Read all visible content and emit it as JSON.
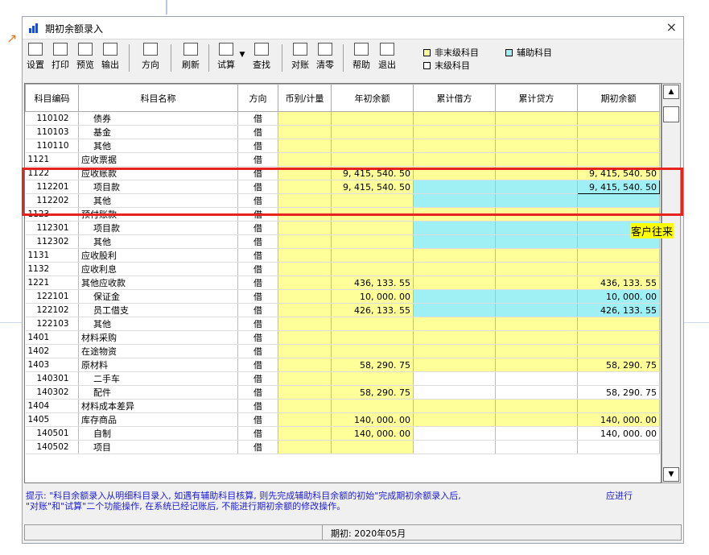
{
  "window": {
    "title": "期初余额录入",
    "close": "×"
  },
  "toolbar": [
    {
      "label": "设置",
      "icon": "settings-icon"
    },
    {
      "label": "打印",
      "icon": "print-icon"
    },
    {
      "label": "预览",
      "icon": "preview-icon"
    },
    {
      "label": "输出",
      "icon": "export-icon"
    },
    {
      "label": "方向",
      "icon": "direction-icon"
    },
    {
      "label": "刷新",
      "icon": "refresh-icon"
    },
    {
      "label": "试算",
      "icon": "trial-balance-icon"
    },
    {
      "label": "查找",
      "icon": "find-icon"
    },
    {
      "label": "对账",
      "icon": "reconcile-icon"
    },
    {
      "label": "清零",
      "icon": "clear-icon"
    },
    {
      "label": "帮助",
      "icon": "help-icon"
    },
    {
      "label": "退出",
      "icon": "exit-icon"
    }
  ],
  "legend": {
    "nonleaf": "非末级科目",
    "leaf": "末级科目",
    "aux": "辅助科目"
  },
  "columns": [
    "科目编码",
    "科目名称",
    "方向",
    "币别/计量",
    "年初余额",
    "累计借方",
    "累计贷方",
    "期初余额"
  ],
  "rows": [
    {
      "code": "110102",
      "name": "债券",
      "dir": "借",
      "open": "",
      "close": "",
      "indent": true,
      "style": "y"
    },
    {
      "code": "110103",
      "name": "基金",
      "dir": "借",
      "open": "",
      "close": "",
      "indent": true,
      "style": "y"
    },
    {
      "code": "110110",
      "name": "其他",
      "dir": "借",
      "open": "",
      "close": "",
      "indent": true,
      "style": "y"
    },
    {
      "code": "1121",
      "name": "应收票据",
      "dir": "借",
      "open": "",
      "close": "",
      "indent": false,
      "style": "y"
    },
    {
      "code": "1122",
      "name": "应收账款",
      "dir": "借",
      "open": "9, 415, 540. 50",
      "close": "9, 415, 540. 50",
      "indent": false,
      "style": "y"
    },
    {
      "code": "112201",
      "name": "项目款",
      "dir": "借",
      "open": "9, 415, 540. 50",
      "close": "9, 415, 540. 50",
      "indent": true,
      "style": "c"
    },
    {
      "code": "112202",
      "name": "其他",
      "dir": "借",
      "open": "",
      "close": "",
      "indent": true,
      "style": "c"
    },
    {
      "code": "1123",
      "name": "预付账款",
      "dir": "借",
      "open": "",
      "close": "",
      "indent": false,
      "style": "y"
    },
    {
      "code": "112301",
      "name": "项目款",
      "dir": "借",
      "open": "",
      "close": "",
      "indent": true,
      "style": "c"
    },
    {
      "code": "112302",
      "name": "其他",
      "dir": "借",
      "open": "",
      "close": "",
      "indent": true,
      "style": "c"
    },
    {
      "code": "1131",
      "name": "应收股利",
      "dir": "借",
      "open": "",
      "close": "",
      "indent": false,
      "style": "y"
    },
    {
      "code": "1132",
      "name": "应收利息",
      "dir": "借",
      "open": "",
      "close": "",
      "indent": false,
      "style": "y"
    },
    {
      "code": "1221",
      "name": "其他应收款",
      "dir": "借",
      "open": "436, 133. 55",
      "close": "436, 133. 55",
      "indent": false,
      "style": "y"
    },
    {
      "code": "122101",
      "name": "保证金",
      "dir": "借",
      "open": "10, 000. 00",
      "close": "10, 000. 00",
      "indent": true,
      "style": "c"
    },
    {
      "code": "122102",
      "name": "员工借支",
      "dir": "借",
      "open": "426, 133. 55",
      "close": "426, 133. 55",
      "indent": true,
      "style": "c"
    },
    {
      "code": "122103",
      "name": "其他",
      "dir": "借",
      "open": "",
      "close": "",
      "indent": true,
      "style": "y"
    },
    {
      "code": "1401",
      "name": "材料采购",
      "dir": "借",
      "open": "",
      "close": "",
      "indent": false,
      "style": "y"
    },
    {
      "code": "1402",
      "name": "在途物资",
      "dir": "借",
      "open": "",
      "close": "",
      "indent": false,
      "style": "y"
    },
    {
      "code": "1403",
      "name": "原材料",
      "dir": "借",
      "open": "58, 290. 75",
      "close": "58, 290. 75",
      "indent": false,
      "style": "y"
    },
    {
      "code": "140301",
      "name": "二手车",
      "dir": "借",
      "open": "",
      "close": "",
      "indent": true,
      "style": "w"
    },
    {
      "code": "140302",
      "name": "配件",
      "dir": "借",
      "open": "58, 290. 75",
      "close": "58, 290. 75",
      "indent": true,
      "style": "w"
    },
    {
      "code": "1404",
      "name": "材料成本差异",
      "dir": "借",
      "open": "",
      "close": "",
      "indent": false,
      "style": "y"
    },
    {
      "code": "1405",
      "name": "库存商品",
      "dir": "借",
      "open": "140, 000. 00",
      "close": "140, 000. 00",
      "indent": false,
      "style": "y"
    },
    {
      "code": "140501",
      "name": "自制",
      "dir": "借",
      "open": "140, 000. 00",
      "close": "140, 000. 00",
      "indent": true,
      "style": "w"
    },
    {
      "code": "140502",
      "name": "项目",
      "dir": "借",
      "open": "",
      "close": "",
      "indent": true,
      "style": "w"
    }
  ],
  "hint": {
    "line1": "提示: \"科目余额录入从明细科目录入, 如遇有辅助科目核算, 则先完成辅助科目余额的初始\"完成期初余额录入后,",
    "line2": "\"对账\"和\"试算\"二个功能操作, 在系统已经记账后, 不能进行期初余额的修改操作。",
    "action": "应进行"
  },
  "status": {
    "period": "期初: 2020年05月"
  },
  "annotation": {
    "tip": "客户往来"
  },
  "colors": {
    "yellow": "#ffff99",
    "cyan": "#9ff0f5",
    "highlight": "#e8221e",
    "hint": "#1a1ad6"
  }
}
